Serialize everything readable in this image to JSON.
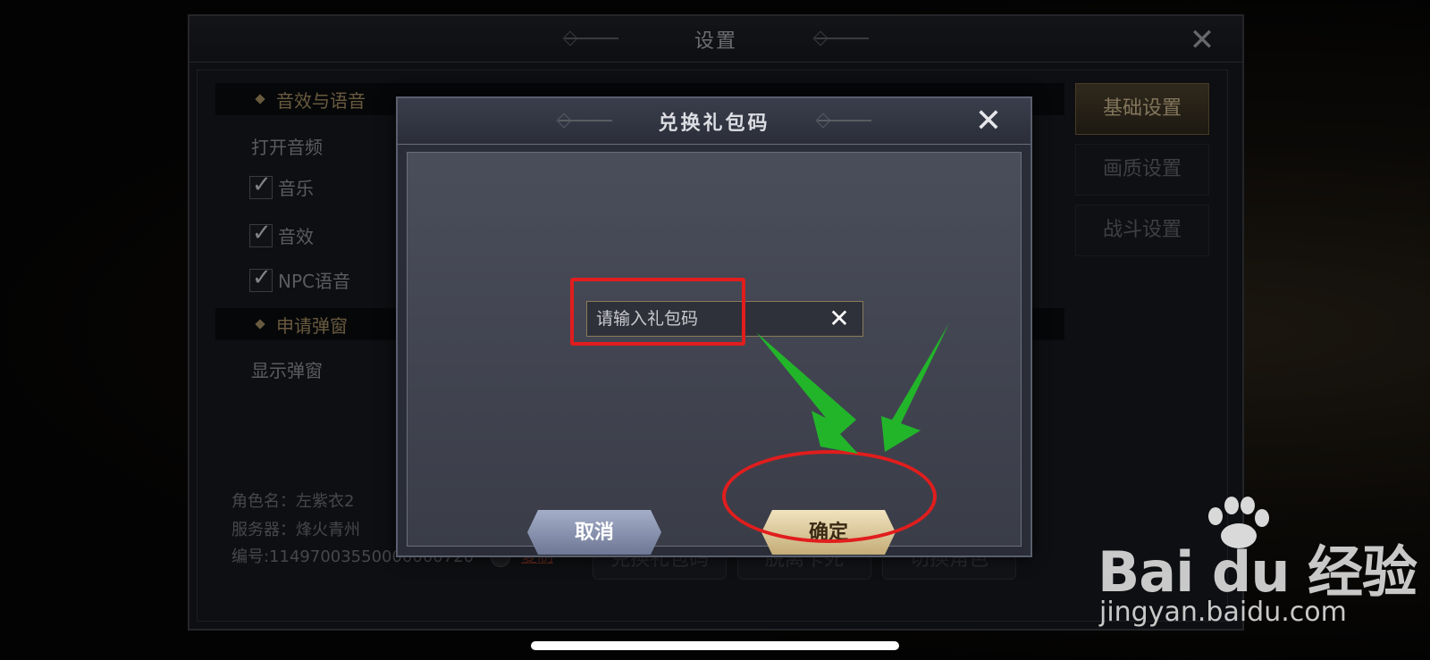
{
  "settings": {
    "title": "设置",
    "sections": [
      {
        "label": "音效与语音"
      },
      {
        "label": "申请弹窗"
      }
    ],
    "open_audio": "打开音频",
    "checks": [
      {
        "label": "音乐",
        "checked": true
      },
      {
        "label": "音效",
        "checked": true
      },
      {
        "label": "NPC语音",
        "checked": true
      }
    ],
    "show_popup": "显示弹窗",
    "tabs": [
      {
        "label": "基础设置",
        "active": true
      },
      {
        "label": "画质设置",
        "active": false
      },
      {
        "label": "战斗设置",
        "active": false
      }
    ],
    "role_name": "角色名：左紫衣2",
    "server": "服务器：烽火青州",
    "id_label": "编号:11497003550000000720",
    "copy_label": "复制",
    "bottom_buttons": [
      "兑换礼包码",
      "脱离卡死",
      "切换角色"
    ]
  },
  "dialog": {
    "title": "兑换礼包码",
    "input_placeholder": "请输入礼包码",
    "cancel_label": "取消",
    "confirm_label": "确定"
  },
  "watermark": {
    "logo": "Bai du 经验",
    "url": "jingyan.baidu.com"
  },
  "colors": {
    "accent_gold": "#c8b48a",
    "annotation_red": "#e11d1d",
    "annotation_green": "#22b52a"
  }
}
